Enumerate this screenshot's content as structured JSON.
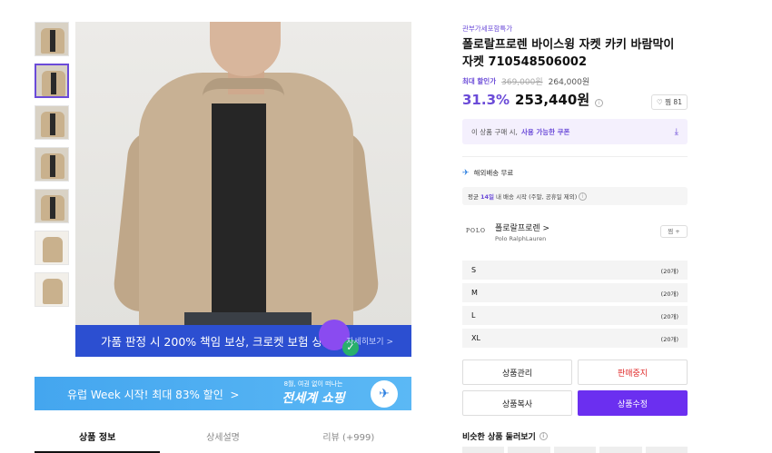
{
  "thumbnails": [
    "thumb1",
    "thumb2",
    "thumb3",
    "thumb4",
    "thumb5",
    "thumb6",
    "thumb7"
  ],
  "main_image": {
    "ribbon_text": "가품 판정 시 200% 책임 보상, 크로켓 보험 상품",
    "ribbon_more": "자세히보기 >"
  },
  "banner": {
    "left_text": "유럽 Week 시작! 최대 83% 할인",
    "chevron": ">",
    "small_text": "8월, 여권 없이 떠나는",
    "big_text": "전세계 쇼핑",
    "plane_icon": "✈"
  },
  "tabs": [
    "상품 정보",
    "상세설명",
    "리뷰 (+999)"
  ],
  "product": {
    "shop_tag": "관부가세포함특가",
    "title": "폴로랄프로렌 바이스윙 자켓 카키 바람막이 자켓 710548506002",
    "discount_label": "최대 할인가",
    "original_price": "369,000원",
    "regular_price": "264,000원",
    "discount_rate": "31.3%",
    "final_price": "253,440원",
    "like_label": "♡ 찜 81"
  },
  "coupon": {
    "text1": "이 상품 구매 시,",
    "text2": "사용 가능한 쿠폰",
    "download_icon": "⤓"
  },
  "shipping": {
    "icon": "✈",
    "label": "해외배송 무료",
    "info_prefix": "평균",
    "info_days": "14일",
    "info_suffix": "내 배송 시작 (주말, 공휴일 제외)"
  },
  "brand": {
    "logo": "POLO",
    "name": "폴로랄프로렌 >",
    "sub": "Polo RalphLauren",
    "follow_label": "찜 +"
  },
  "sizes": [
    {
      "name": "S",
      "qty": "(20개)"
    },
    {
      "name": "M",
      "qty": "(20개)"
    },
    {
      "name": "L",
      "qty": "(20개)"
    },
    {
      "name": "XL",
      "qty": "(20개)"
    }
  ],
  "buttons": {
    "manage": "상품관리",
    "stop": "판매중지",
    "copy": "상품복사",
    "edit": "상품수정"
  },
  "similar": {
    "title": "비슷한 상품 둘러보기"
  }
}
